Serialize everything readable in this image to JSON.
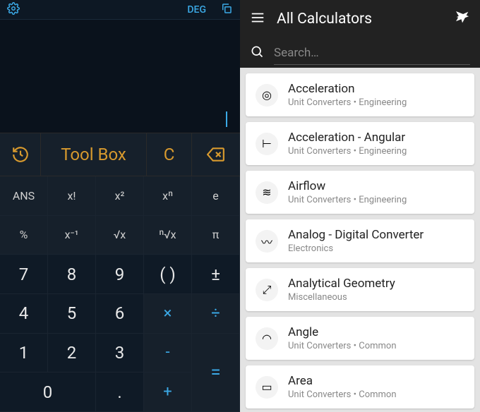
{
  "calculator": {
    "mode": "DEG",
    "toolrow": {
      "toolbox": "Tool Box",
      "clear": "C"
    },
    "keys_fn_row1": [
      "ANS",
      "x!",
      "x²",
      "xⁿ",
      "e"
    ],
    "keys_fn_row2": [
      "%",
      "x⁻¹",
      "√x",
      "ⁿ√x",
      "π"
    ],
    "keys_num_rows": [
      [
        "7",
        "8",
        "9",
        "( )",
        "±"
      ],
      [
        "4",
        "5",
        "6",
        "×",
        "÷"
      ],
      [
        "1",
        "2",
        "3",
        "-",
        "="
      ],
      [
        "0",
        ".",
        "+",
        ""
      ]
    ]
  },
  "list": {
    "title": "All Calculators",
    "search_placeholder": "Search…",
    "items": [
      {
        "title": "Acceleration",
        "sub": "Unit Converters • Engineering",
        "icon": "◎"
      },
      {
        "title": "Acceleration - Angular",
        "sub": "Unit Converters • Engineering",
        "icon": "⊢"
      },
      {
        "title": "Airflow",
        "sub": "Unit Converters • Engineering",
        "icon": "≋"
      },
      {
        "title": "Analog - Digital Converter",
        "sub": "Electronics",
        "icon": "〰"
      },
      {
        "title": "Analytical Geometry",
        "sub": "Miscellaneous",
        "icon": "⤢"
      },
      {
        "title": "Angle",
        "sub": "Unit Converters • Common",
        "icon": "◠"
      },
      {
        "title": "Area",
        "sub": "Unit Converters • Common",
        "icon": "▭"
      }
    ]
  }
}
